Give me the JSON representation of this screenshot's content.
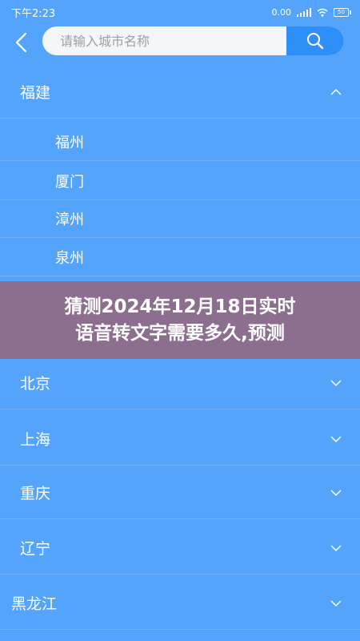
{
  "status_bar": {
    "time": "下午2:23",
    "speed": "0.00",
    "battery": "50"
  },
  "search": {
    "placeholder": "请输入城市名称"
  },
  "provinces": {
    "fujian": {
      "label": "福建",
      "cities": [
        "福州",
        "厦门",
        "漳州",
        "泉州"
      ]
    },
    "beijing": {
      "label": "北京"
    },
    "shanghai": {
      "label": "上海"
    },
    "chongqing": {
      "label": "重庆"
    },
    "liaoning": {
      "label": "辽宁"
    },
    "heilongjiang": {
      "label": "黑龙江"
    }
  },
  "banner": {
    "line1": "猜测2024年12月18日实时",
    "line2": "语音转文字需要多久,预测"
  },
  "colors": {
    "background": "#54a4fb",
    "search_button": "#2e8ff8",
    "banner": "#8c6f8f"
  }
}
